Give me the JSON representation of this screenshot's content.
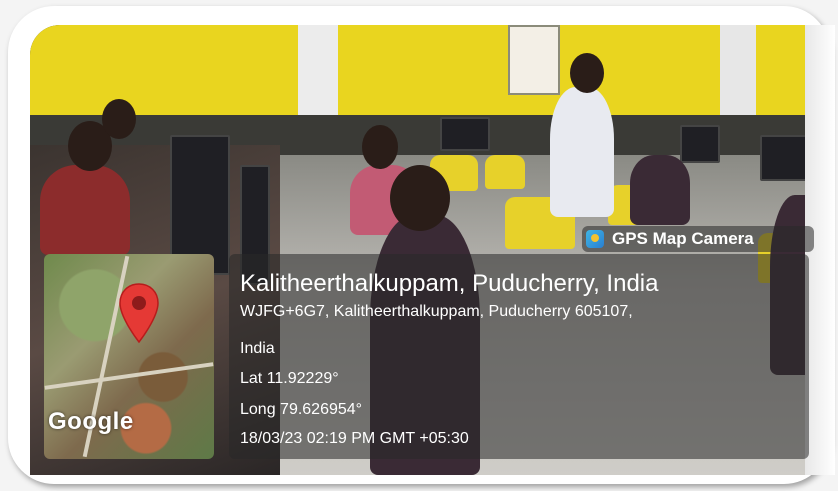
{
  "overlay": {
    "app_badge": "GPS Map Camera",
    "location_title": "Kalitheerthalkuppam, Puducherry, India",
    "address_line1": "WJFG+6G7, Kalitheerthalkuppam, Puducherry 605107,",
    "address_line2": "India",
    "latitude": "Lat 11.92229°",
    "longitude": "Long 79.626954°",
    "timestamp": "18/03/23 02:19 PM GMT +05:30",
    "map_watermark": "Google"
  },
  "icons": {
    "badge": "gps-map-camera-icon",
    "pin": "map-pin-icon"
  },
  "colors": {
    "pin": "#e53935",
    "wall": "#e9d51f",
    "chair": "#e7d12a"
  }
}
